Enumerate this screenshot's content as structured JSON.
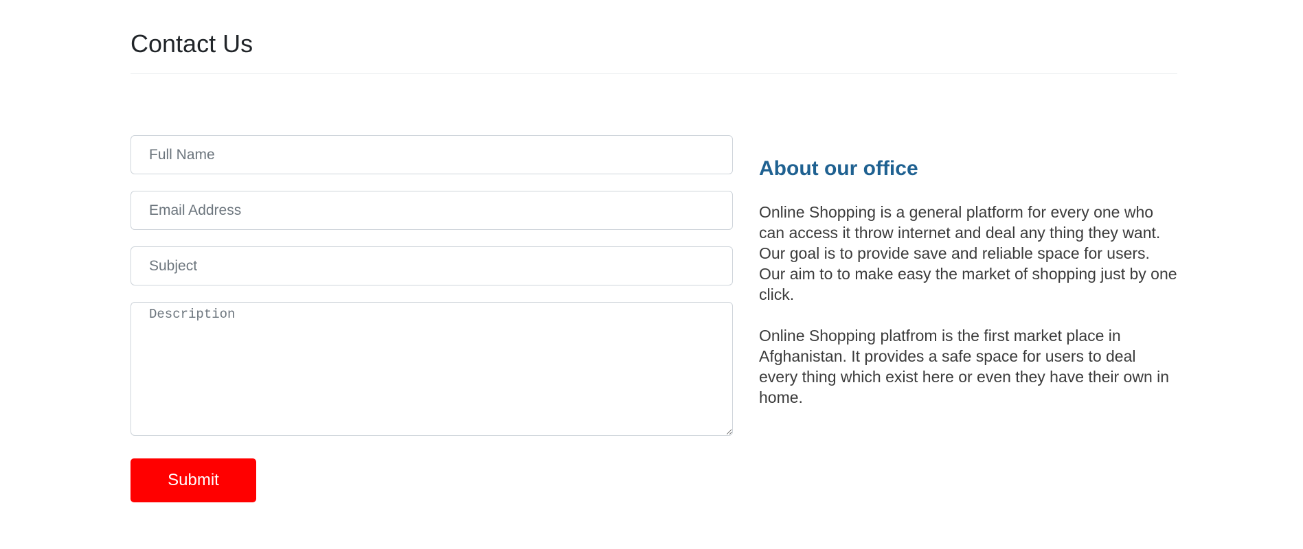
{
  "header": {
    "title": "Contact Us"
  },
  "form": {
    "full_name_placeholder": "Full Name",
    "email_placeholder": "Email Address",
    "subject_placeholder": "Subject",
    "description_placeholder": "Description",
    "submit_label": "Submit"
  },
  "about": {
    "title": "About our office",
    "paragraphs": [
      "Online Shopping is a general platform for every one who can access it throw internet and deal any thing they want. Our goal is to provide save and reliable space for users. Our aim to to make easy the market of shopping just by one click.",
      "Online Shopping platfrom is the first market place in Afghanistan. It provides a safe space for users to deal every thing which exist here or even they have their own in home."
    ]
  },
  "colors": {
    "submit_button": "#ff0000",
    "about_title": "#1f6191",
    "divider": "#e9ecef"
  }
}
